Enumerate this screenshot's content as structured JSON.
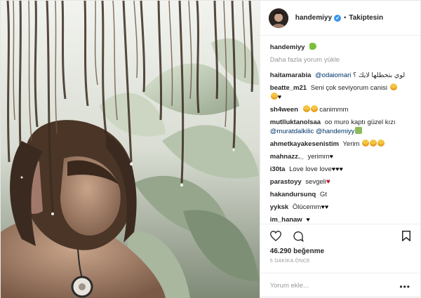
{
  "header": {
    "username": "handemiyy",
    "verified_badge": "✔",
    "separator": "•",
    "follow_label": "Takiptesin"
  },
  "caption": {
    "username": "handemiyy",
    "emoji": "crocodile-emoji"
  },
  "load_more_label": "Daha fazla yorum yükle",
  "comments": [
    {
      "user": "haitamarabia",
      "mention": "@odaiomari",
      "text": "لوي بتحطلها لايك ؟",
      "emoji": []
    },
    {
      "user": "beatte_m21",
      "text": "Seni çok seviyorum canisi",
      "emoji": [
        "smile"
      ]
    },
    {
      "user": "",
      "text": "",
      "emoji": [
        "smile",
        "heart"
      ]
    },
    {
      "user": "sh4ween",
      "text": "canimmm",
      "emoji_before": [
        "smile",
        "smile"
      ]
    },
    {
      "user": "mutlluktanolsaa",
      "text": "oo muro kaptı güzel kızı",
      "mentions": [
        "@muratdalkilic",
        "@handemiyy"
      ]
    },
    {
      "user": "ahmetkayakesenistim",
      "text": "Yerim",
      "emoji": [
        "smile",
        "smile",
        "smile"
      ]
    },
    {
      "user": "mahnazz._",
      "text": "yerimm",
      "emoji": [
        "heart"
      ]
    },
    {
      "user": "i30ta",
      "text": "Love love love",
      "emoji": [
        "heart",
        "heart",
        "heart"
      ]
    },
    {
      "user": "parastoyy",
      "text": "sevgeli",
      "emoji": [
        "heart-red"
      ]
    },
    {
      "user": "hakandursunq",
      "text": "Gt"
    },
    {
      "user": "yyksk",
      "text": "Ölücemm",
      "emoji": [
        "heart",
        "heart"
      ]
    },
    {
      "user": "im_hanaw",
      "text": "",
      "emoji": [
        "heart"
      ]
    }
  ],
  "likes_label": "46.290 beğenme",
  "timestamp": "5 DAKİKA ÖNCE",
  "add_comment_placeholder": "Yorum ekle...",
  "menu_glyph": "•••",
  "colors": {
    "link": "#003569",
    "verified": "#3897f0",
    "muted": "#999999",
    "text": "#262626"
  }
}
